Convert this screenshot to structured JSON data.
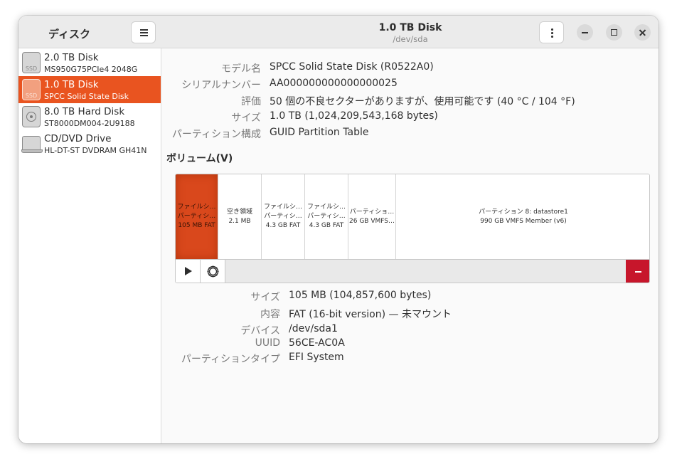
{
  "sidebar": {
    "title": "ディスク",
    "disks": [
      {
        "name": "2.0 TB Disk",
        "model": "MS950G75PCIe4 2048G",
        "icon": "ssd-icon",
        "icon_tag": "SSD"
      },
      {
        "name": "1.0 TB Disk",
        "model": "SPCC Solid State Disk",
        "icon": "ssd-icon",
        "icon_tag": "SSD"
      },
      {
        "name": "8.0 TB Hard Disk",
        "model": "ST8000DM004-2U9188",
        "icon": "hdd-icon"
      },
      {
        "name": "CD/DVD Drive",
        "model": "HL-DT-ST DVDRAM GH41N",
        "icon": "optical-drive-icon"
      }
    ]
  },
  "header": {
    "title": "1.0 TB Disk",
    "subtitle": "/dev/sda"
  },
  "disk_info": {
    "model": {
      "label": "モデル名",
      "value": "SPCC Solid State Disk (R0522A0)"
    },
    "serial": {
      "label": "シリアルナンバー",
      "value": "AA000000000000000025"
    },
    "assessment": {
      "label": "評価",
      "value": "50 個の不良セクターがありますが、使用可能です (40 °C / 104 °F)"
    },
    "size": {
      "label": "サイズ",
      "value": "1.0 TB (1,024,209,543,168 bytes)"
    },
    "partitioning": {
      "label": "パーティション構成",
      "value": "GUID Partition Table"
    }
  },
  "volumes": {
    "title": "ボリューム(V)",
    "partitions": [
      {
        "line1": "ファイルシ…",
        "line2": "パーティシ…",
        "line3": "105 MB FAT"
      },
      {
        "line1": "空き領域",
        "line2": "2.1 MB"
      },
      {
        "line1": "ファイルシ…",
        "line2": "パーティシ…",
        "line3": "4.3 GB FAT"
      },
      {
        "line1": "ファイルシ…",
        "line2": "パーティシ…",
        "line3": "4.3 GB FAT"
      },
      {
        "line1": "パーティショ…",
        "line2": "26 GB VMFS …"
      },
      {
        "line1": "パーティション 8: datastore1",
        "line2": "990 GB VMFS Member (v6)"
      }
    ]
  },
  "partition_info": {
    "size": {
      "label": "サイズ",
      "value": "105 MB (104,857,600 bytes)"
    },
    "contents": {
      "label": "内容",
      "value": "FAT (16-bit version) — 未マウント"
    },
    "device": {
      "label": "デバイス",
      "value": "/dev/sda1"
    },
    "uuid": {
      "label": "UUID",
      "value": "56CE-AC0A"
    },
    "type": {
      "label": "パーティションタイプ",
      "value": "EFI System"
    }
  },
  "colors": {
    "accent": "#e95420",
    "selected_partition": "#d9481c",
    "destructive": "#c7162b"
  }
}
